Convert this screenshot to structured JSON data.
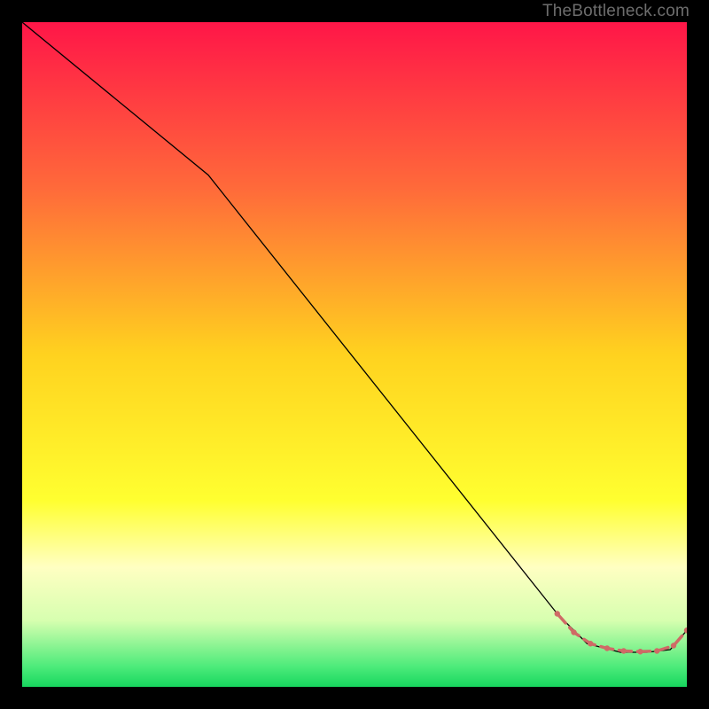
{
  "watermark": "TheBottleneck.com",
  "chart_data": {
    "type": "line",
    "title": "",
    "xlabel": "",
    "ylabel": "",
    "xlim": [
      0,
      100
    ],
    "ylim": [
      0,
      100
    ],
    "background_gradient": {
      "stops": [
        {
          "offset": 0,
          "color": "#ff1648"
        },
        {
          "offset": 25,
          "color": "#ff6a3a"
        },
        {
          "offset": 50,
          "color": "#ffd21f"
        },
        {
          "offset": 72,
          "color": "#ffff30"
        },
        {
          "offset": 82,
          "color": "#ffffc2"
        },
        {
          "offset": 90,
          "color": "#d7ffb0"
        },
        {
          "offset": 97,
          "color": "#4ceb7a"
        },
        {
          "offset": 100,
          "color": "#17d65e"
        }
      ]
    },
    "series": [
      {
        "name": "main-curve",
        "color": "#000000",
        "thick": 1.3,
        "x": [
          0,
          28,
          80.5,
          85,
          90,
          94,
          97.5,
          100
        ],
        "y": [
          100,
          77,
          11,
          6.5,
          5.2,
          5.2,
          5.6,
          8.5
        ]
      },
      {
        "name": "marker-track",
        "color": "#cf6a66",
        "thick": 3.5,
        "dashed": true,
        "x": [
          80.5,
          83,
          85.5,
          88,
          90.5,
          93,
          95.5,
          98,
          100
        ],
        "y": [
          11,
          8.2,
          6.5,
          5.8,
          5.4,
          5.3,
          5.4,
          6.2,
          8.5
        ],
        "dot_radius": 3.2
      }
    ]
  }
}
